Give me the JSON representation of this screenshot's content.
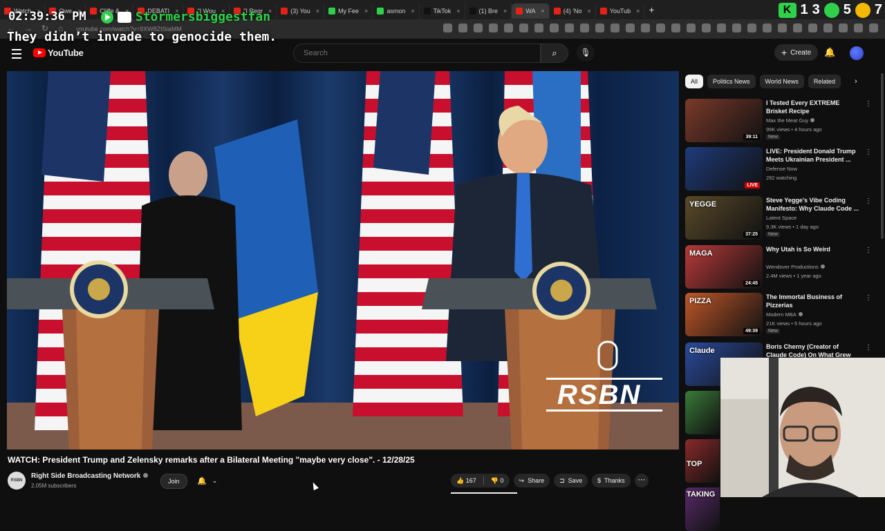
{
  "overlay": {
    "clock": "02:39:36 PM",
    "username": "Stormersbiggestfan",
    "caption": "They didn’t invade to genocide them.",
    "corner_num1": "1",
    "corner_num2": "3",
    "corner_num3": "5",
    "corner_num4": "7"
  },
  "browser": {
    "tabs": [
      {
        "label": "Watch",
        "color": "#e62117"
      },
      {
        "label": "Owe",
        "color": "#e62117"
      },
      {
        "label": "Cliffe &",
        "color": "#e62117"
      },
      {
        "label": "DEBATI",
        "color": "#e62117"
      },
      {
        "label": "\"I Wou",
        "color": "#e62117"
      },
      {
        "label": "\"I Regr",
        "color": "#e62117"
      },
      {
        "label": "(3) You",
        "color": "#e62117"
      },
      {
        "label": "My Fee",
        "color": "#2fd14a"
      },
      {
        "label": "asmon",
        "color": "#2fd14a"
      },
      {
        "label": "TikTok",
        "color": "#111111"
      },
      {
        "label": "(1) Bre",
        "color": "#111111"
      },
      {
        "label": "WA",
        "color": "#e62117"
      },
      {
        "label": "(4) 'No",
        "color": "#e62117"
      },
      {
        "label": "YouTub",
        "color": "#e62117"
      }
    ],
    "active_tab_index": 11,
    "url": "youtube.com/watch?v=9XW8ZtSiaMM"
  },
  "masthead": {
    "logo": "YouTube",
    "search_placeholder": "Search",
    "create_label": "Create"
  },
  "video": {
    "title": "WATCH: President Trump and Zelensky remarks after a Bilateral Meeting \"maybe very close\". - 12/28/25",
    "watermark": "RSBN",
    "channel": {
      "name": "Right Side Broadcasting Network",
      "subscribers": "2.05M subscribers",
      "avatar_text": "RSBN"
    },
    "join_label": "Join",
    "likes": "167",
    "dislikes": "0",
    "share_label": "Share",
    "save_label": "Save",
    "thanks_label": "Thanks"
  },
  "sidebar": {
    "chips": [
      "All",
      "Politics News",
      "World News",
      "Related"
    ],
    "recommendations": [
      {
        "title": "I Tested Every EXTREME Brisket Recipe",
        "channel": "Max the Meat Guy",
        "verified": true,
        "meta": "99K views • 4 hours ago",
        "badge": "New",
        "duration": "39:11",
        "thumb": "#7a3a2a"
      },
      {
        "title": "LIVE: President Donald Trump Meets Ukrainian President ...",
        "channel": "Defense Now",
        "verified": false,
        "meta": "292 watching",
        "badge": "",
        "duration": "LIVE",
        "thumb": "#1f3b7a"
      },
      {
        "title": "Steve Yegge's Vibe Coding Manifesto: Why Claude Code ...",
        "channel": "Latent Space",
        "verified": false,
        "meta": "9.3K views • 1 day ago",
        "badge": "New",
        "duration": "37:25",
        "thumb": "#5a4a2a"
      },
      {
        "title": "Why Utah is So Weird",
        "channel": "Wendover Productions",
        "verified": true,
        "meta": "2.4M views • 1 year ago",
        "badge": "",
        "duration": "24:45",
        "thumb": "#b83a3a"
      },
      {
        "title": "The Immortal Business of Pizzerias",
        "channel": "Modern MBA",
        "verified": true,
        "meta": "21K views • 5 hours ago",
        "badge": "New",
        "duration": "49:39",
        "thumb": "#c0572a"
      },
      {
        "title": "Boris Cherny (Creator of Claude Code) On What Grew His Care...",
        "channel": "",
        "verified": false,
        "meta": "",
        "badge": "",
        "duration": "",
        "thumb": "#2a4a9a"
      }
    ],
    "thumb_label_claude": "Claude",
    "thumb_label_yegge": "YEGGE",
    "thumb_label_maga": "MAGA",
    "thumb_label_pizza": "PIZZA",
    "thumb_label_top": "TOP",
    "thumb_label_taking": "TAKING"
  }
}
